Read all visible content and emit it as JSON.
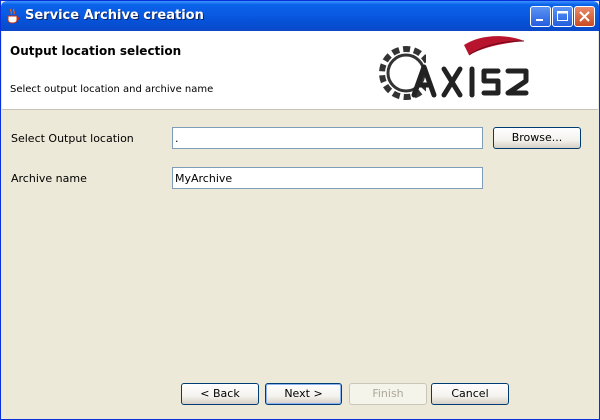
{
  "window": {
    "title": "Service Archive creation",
    "controls": {
      "minimize": "minimize",
      "maximize": "maximize",
      "close": "close"
    }
  },
  "header": {
    "title": "Output location selection",
    "subtitle": "Select output location and archive name",
    "logo_text": "AXIS2"
  },
  "form": {
    "output_location_label": "Select Output location",
    "output_location_value": ".",
    "browse_label": "Browse...",
    "archive_name_label": "Archive name",
    "archive_name_value": "MyArchive"
  },
  "buttons": {
    "back": "< Back",
    "next": "Next >",
    "finish": "Finish",
    "cancel": "Cancel"
  },
  "icons": [
    "java-cup-icon",
    "minimize-icon",
    "maximize-icon",
    "close-icon",
    "axis2-logo"
  ]
}
